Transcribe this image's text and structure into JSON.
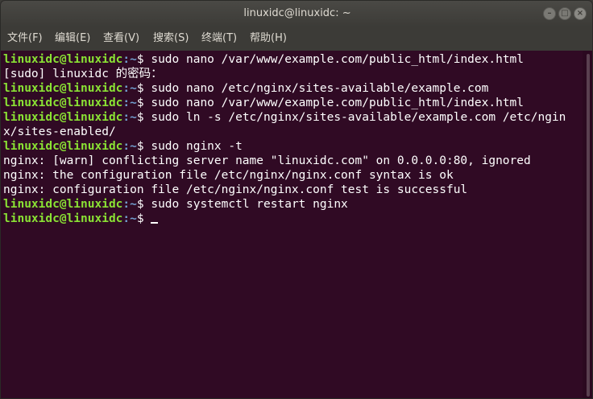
{
  "window": {
    "title": "linuxidc@linuxidc: ~",
    "buttons": {
      "minimize": "–",
      "maximize": "□",
      "close": "×"
    }
  },
  "menu": [
    {
      "label": "文件(F)"
    },
    {
      "label": "编辑(E)"
    },
    {
      "label": "查看(V)"
    },
    {
      "label": "搜索(S)"
    },
    {
      "label": "终端(T)"
    },
    {
      "label": "帮助(H)"
    }
  ],
  "colors": {
    "background": "#300a24",
    "prompt_user": "#8ae234",
    "prompt_path": "#729fcf",
    "text": "#ffffff"
  },
  "terminal": {
    "prompt_user": "linuxidc@linuxidc",
    "prompt_path": ":~",
    "prompt_symbol": "$ ",
    "lines": [
      {
        "type": "prompt",
        "text": "sudo nano /var/www/example.com/public_html/index.html"
      },
      {
        "type": "output",
        "text": "[sudo] linuxidc 的密码："
      },
      {
        "type": "prompt",
        "text": "sudo nano /etc/nginx/sites-available/example.com"
      },
      {
        "type": "prompt",
        "text": "sudo nano /var/www/example.com/public_html/index.html"
      },
      {
        "type": "prompt",
        "text": "sudo ln -s /etc/nginx/sites-available/example.com /etc/ngin"
      },
      {
        "type": "output",
        "text": "x/sites-enabled/"
      },
      {
        "type": "prompt",
        "text": "sudo nginx -t"
      },
      {
        "type": "output",
        "text": "nginx: [warn] conflicting server name \"linuxidc.com\" on 0.0.0.0:80, ignored"
      },
      {
        "type": "output",
        "text": "nginx: the configuration file /etc/nginx/nginx.conf syntax is ok"
      },
      {
        "type": "output",
        "text": "nginx: configuration file /etc/nginx/nginx.conf test is successful"
      },
      {
        "type": "prompt",
        "text": "sudo systemctl restart nginx"
      },
      {
        "type": "prompt",
        "text": ""
      }
    ]
  }
}
